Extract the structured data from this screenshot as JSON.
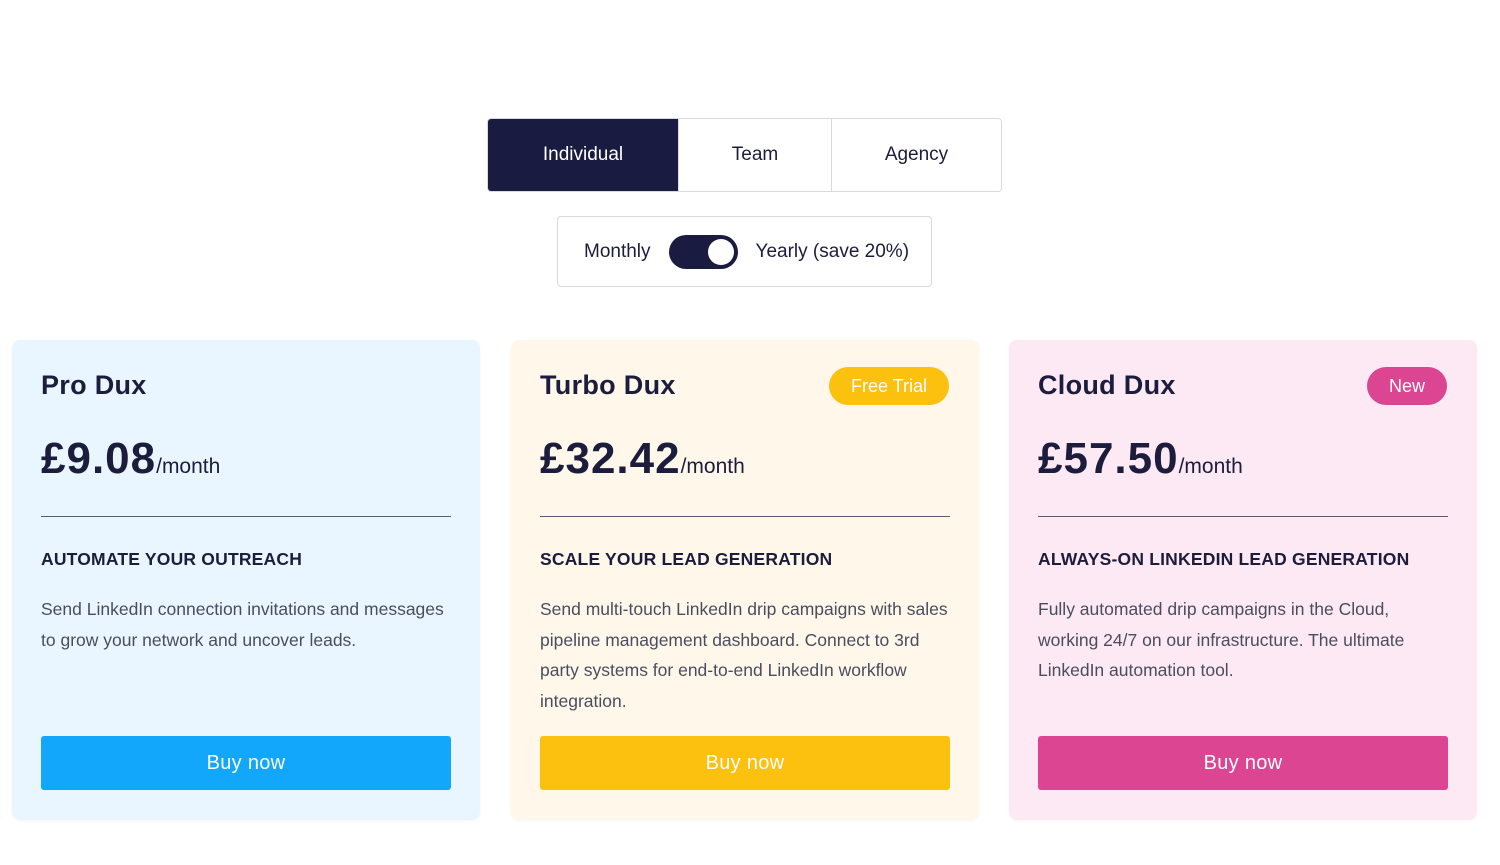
{
  "plan_tabs": [
    "Individual",
    "Team",
    "Agency"
  ],
  "active_tab": "Individual",
  "billing": {
    "monthly_label": "Monthly",
    "yearly_label": "Yearly (save 20%)",
    "toggle_on": true
  },
  "cards": [
    {
      "title": "Pro Dux",
      "badge": "",
      "price": "£9.08",
      "period": "/month",
      "headline": "AUTOMATE YOUR OUTREACH",
      "description": "Send LinkedIn connection invitations and messages to grow your network and uncover leads.",
      "button": "Buy now",
      "bg_color": "#e9f6ff",
      "accent_color": "#12a7fb"
    },
    {
      "title": "Turbo Dux",
      "badge": "Free Trial",
      "price": "£32.42",
      "period": "/month",
      "headline": "SCALE YOUR LEAD GENERATION",
      "description": "Send multi-touch LinkedIn drip campaigns with sales pipeline management dashboard. Connect to 3rd party systems for end-to-end LinkedIn workflow integration.",
      "button": "Buy now",
      "bg_color": "#fff8ea",
      "accent_color": "#fcc00e"
    },
    {
      "title": "Cloud Dux",
      "badge": "New",
      "price": "£57.50",
      "period": "/month",
      "headline": "ALWAYS-ON LINKEDIN LEAD GENERATION",
      "description": "Fully automated drip campaigns in the Cloud, working 24/7 on our infrastructure. The ultimate LinkedIn automation tool.",
      "button": "Buy now",
      "bg_color": "#fde9f4",
      "accent_color": "#dc4592"
    }
  ],
  "colors": {
    "navy": "#191b40"
  }
}
